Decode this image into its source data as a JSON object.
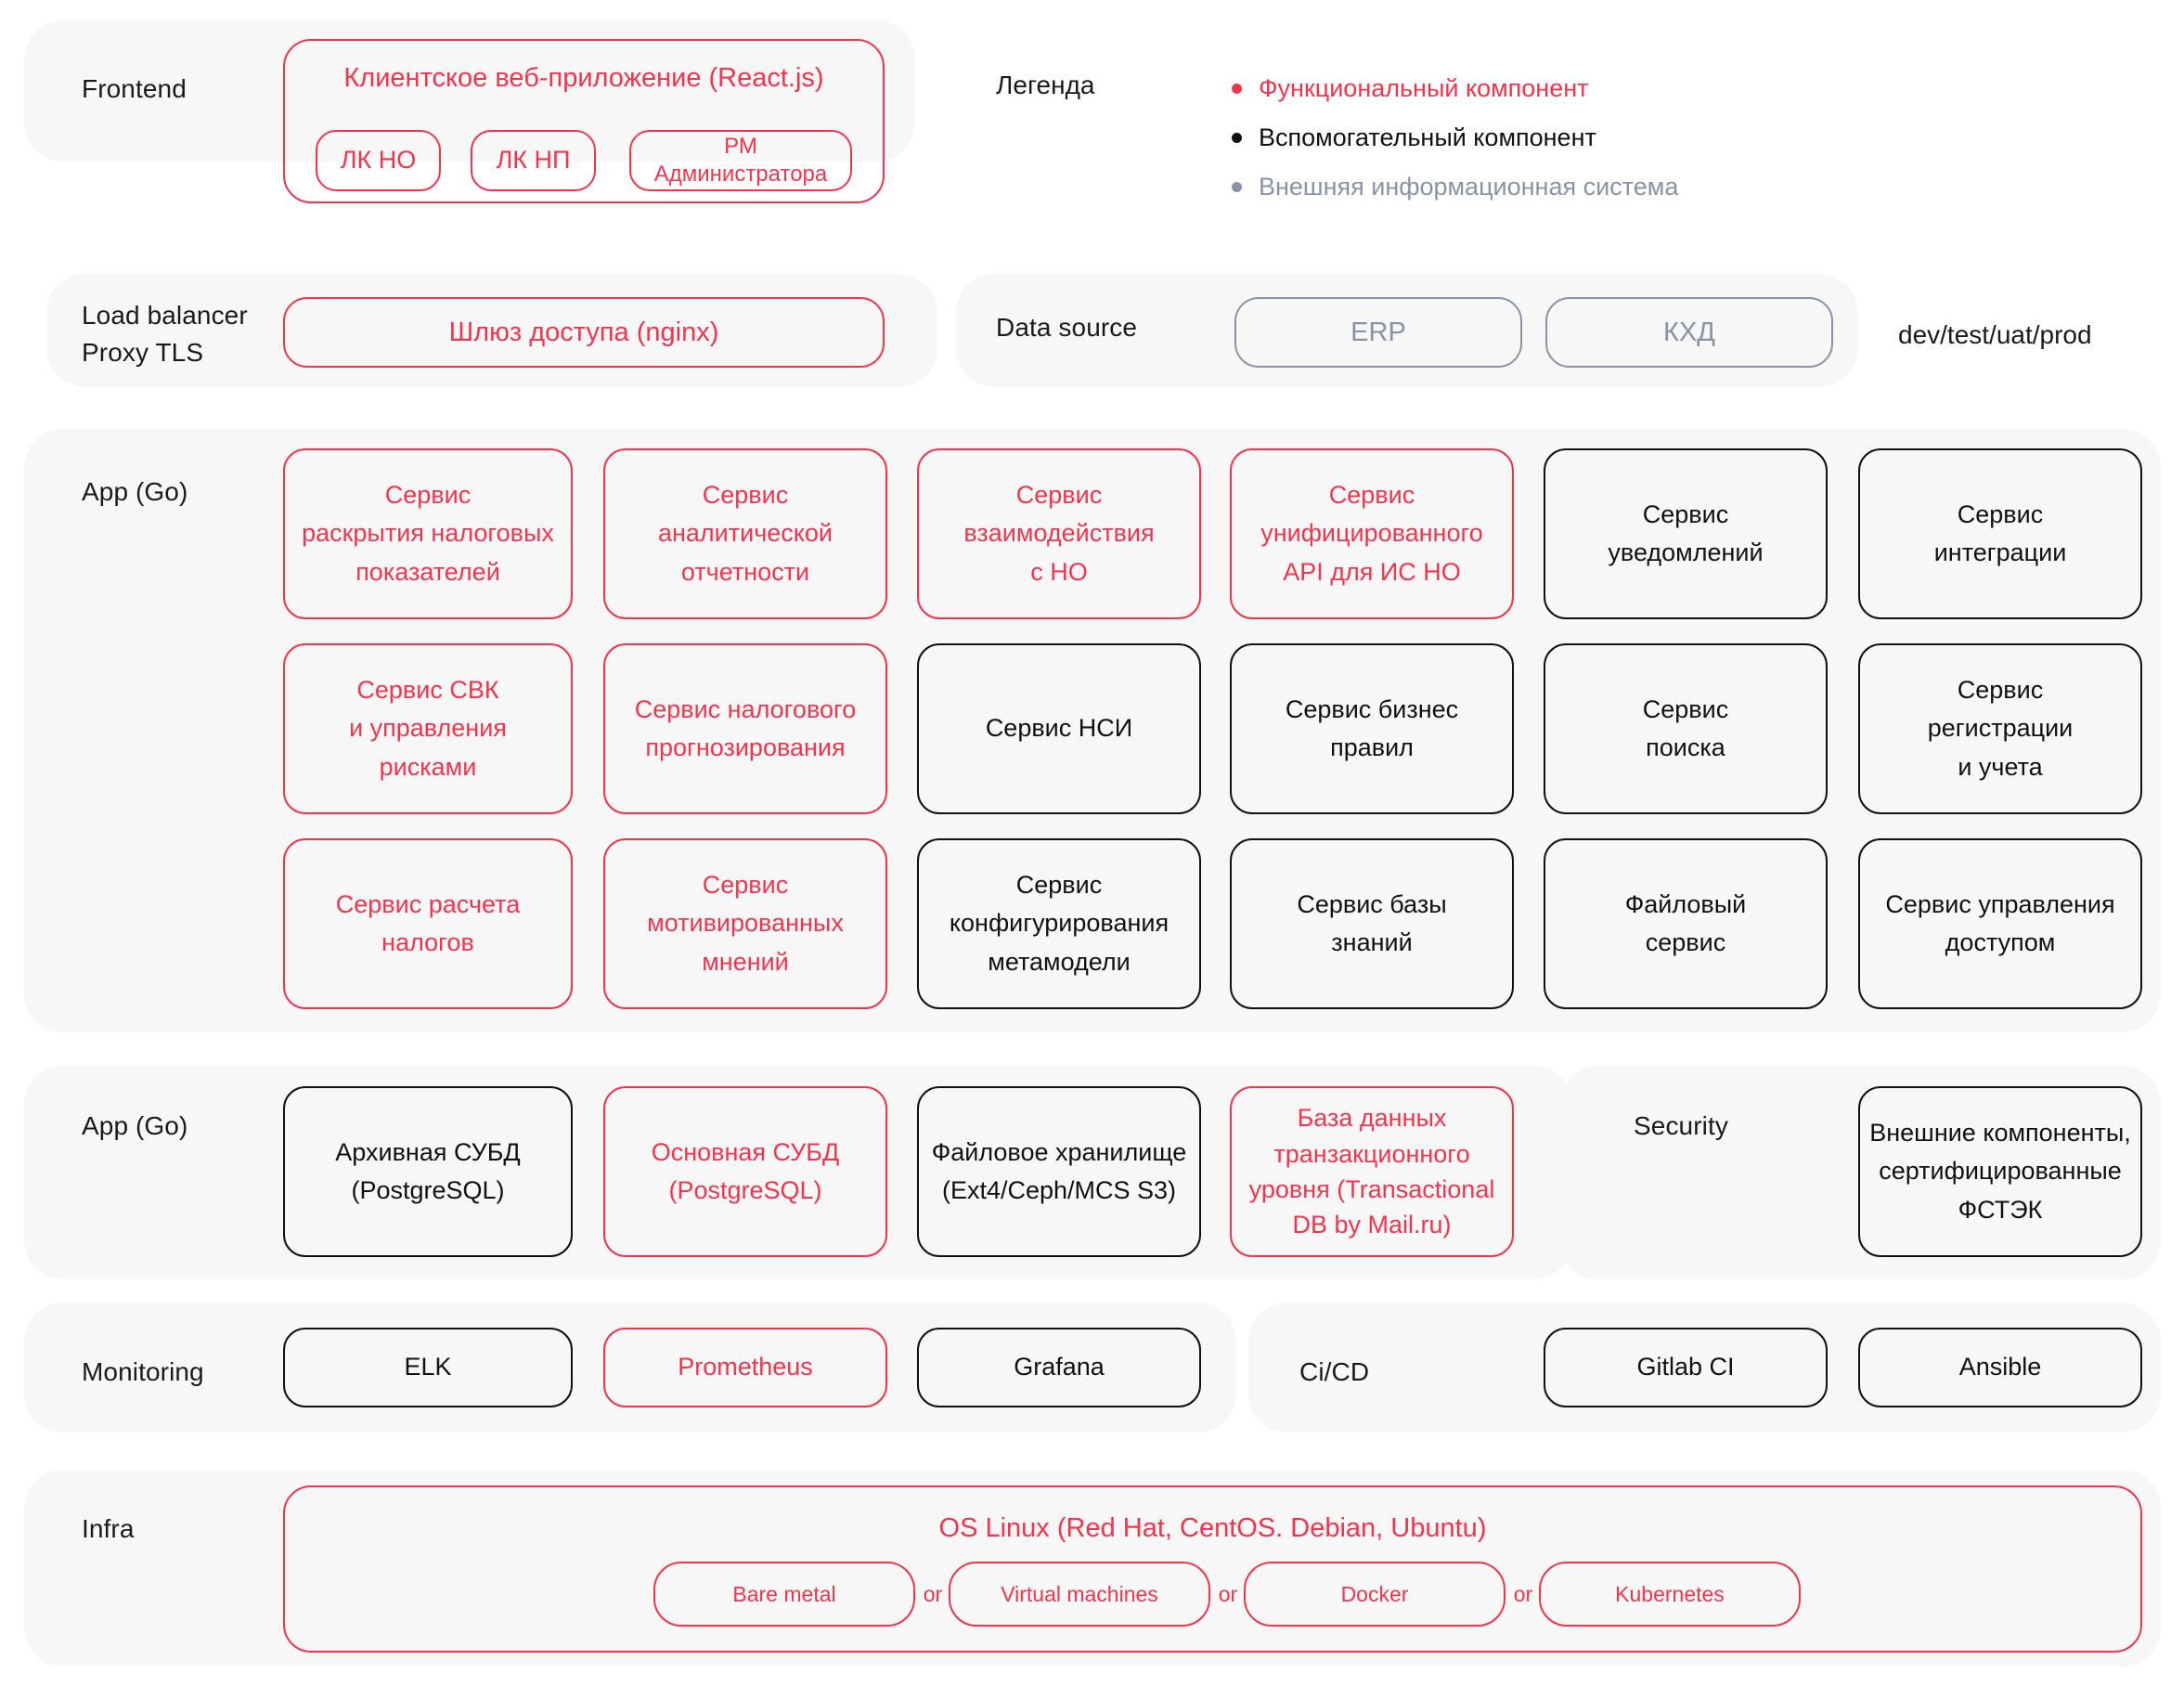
{
  "colors": {
    "functional": "#f4344d",
    "auxiliary": "#111111",
    "external": "#8a93a6",
    "panel_bg": "#f7f7f7",
    "page_bg": "#ffffff"
  },
  "legend": {
    "title": "Легенда",
    "items": [
      {
        "label": "Функциональный компонент",
        "color": "#f4344d"
      },
      {
        "label": "Вспомогательный компонент",
        "color": "#111111"
      },
      {
        "label": "Внешняя информационная система",
        "color": "#8a93a6"
      }
    ]
  },
  "rows": {
    "frontend": {
      "label": "Frontend",
      "container_title": "Клиентское веб-приложение (React.js)",
      "items": [
        {
          "label": "ЛК НО",
          "kind": "functional"
        },
        {
          "label": "ЛК НП",
          "kind": "functional"
        },
        {
          "label": "РМ\nАдминистратора",
          "kind": "functional"
        }
      ]
    },
    "load_balancer": {
      "label": "Load balancer\nProxy TLS",
      "items": [
        {
          "label": "Шлюз доступа (nginx)",
          "kind": "functional"
        }
      ]
    },
    "data_source": {
      "label": "Data source",
      "items": [
        {
          "label": "ERP",
          "kind": "external"
        },
        {
          "label": "КХД",
          "kind": "external"
        }
      ],
      "environments": "dev/test/uat/prod"
    },
    "app_services": {
      "label": "App (Go)",
      "grid": [
        [
          {
            "label": "Сервис\nраскрытия налоговых\nпоказателей",
            "kind": "functional"
          },
          {
            "label": "Сервис\nаналитической\nотчетности",
            "kind": "functional"
          },
          {
            "label": "Сервис\nвзаимодействия\nс НО",
            "kind": "functional"
          },
          {
            "label": "Сервис\nунифицированного\nAPI для ИС НО",
            "kind": "functional"
          },
          {
            "label": "Сервис\nуведомлений",
            "kind": "auxiliary"
          },
          {
            "label": "Сервис\nинтеграции",
            "kind": "auxiliary"
          }
        ],
        [
          {
            "label": "Сервис СВК\nи управления\nрисками",
            "kind": "functional"
          },
          {
            "label": "Сервис налогового\nпрогнозирования",
            "kind": "functional"
          },
          {
            "label": "Сервис НСИ",
            "kind": "auxiliary"
          },
          {
            "label": "Сервис бизнес\nправил",
            "kind": "auxiliary"
          },
          {
            "label": "Сервис\nпоиска",
            "kind": "auxiliary"
          },
          {
            "label": "Сервис\nрегистрации\nи учета",
            "kind": "auxiliary"
          }
        ],
        [
          {
            "label": "Сервис расчета\nналогов",
            "kind": "functional"
          },
          {
            "label": "Сервис\nмотивированных\nмнений",
            "kind": "functional"
          },
          {
            "label": "Сервис\nконфигурирования\nметамодели",
            "kind": "auxiliary"
          },
          {
            "label": "Сервис базы\nзнаний",
            "kind": "auxiliary"
          },
          {
            "label": "Файловый\nсервис",
            "kind": "auxiliary"
          },
          {
            "label": "Сервис управления\nдоступом",
            "kind": "auxiliary"
          }
        ]
      ]
    },
    "app_data": {
      "label": "App (Go)",
      "items": [
        {
          "label": "Архивная СУБД\n(PostgreSQL)",
          "kind": "auxiliary"
        },
        {
          "label": "Основная СУБД\n(PostgreSQL)",
          "kind": "functional"
        },
        {
          "label": "Файловое хранилище\n(Ext4/Ceph/MCS S3)",
          "kind": "auxiliary"
        },
        {
          "label": "База данных\nтранзакционного\nуровня (Transactional\nDB by Mail.ru)",
          "kind": "functional"
        }
      ]
    },
    "security": {
      "label": "Security",
      "items": [
        {
          "label": "Внешние компоненты,\nсертифицированные\nФСТЭК",
          "kind": "auxiliary"
        }
      ]
    },
    "monitoring": {
      "label": "Monitoring",
      "items": [
        {
          "label": "ELK",
          "kind": "auxiliary"
        },
        {
          "label": "Prometheus",
          "kind": "functional"
        },
        {
          "label": "Grafana",
          "kind": "auxiliary"
        }
      ]
    },
    "cicd": {
      "label": "Ci/CD",
      "items": [
        {
          "label": "Gitlab CI",
          "kind": "auxiliary"
        },
        {
          "label": "Ansible",
          "kind": "auxiliary"
        }
      ]
    },
    "infra": {
      "label": "Infra",
      "container_title": "OS Linux (Red Hat, CentOS. Debian, Ubuntu)",
      "separator": "or",
      "items": [
        {
          "label": "Bare metal",
          "kind": "functional"
        },
        {
          "label": "Virtual machines",
          "kind": "functional"
        },
        {
          "label": "Docker",
          "kind": "functional"
        },
        {
          "label": "Kubernetes",
          "kind": "functional"
        }
      ]
    }
  }
}
